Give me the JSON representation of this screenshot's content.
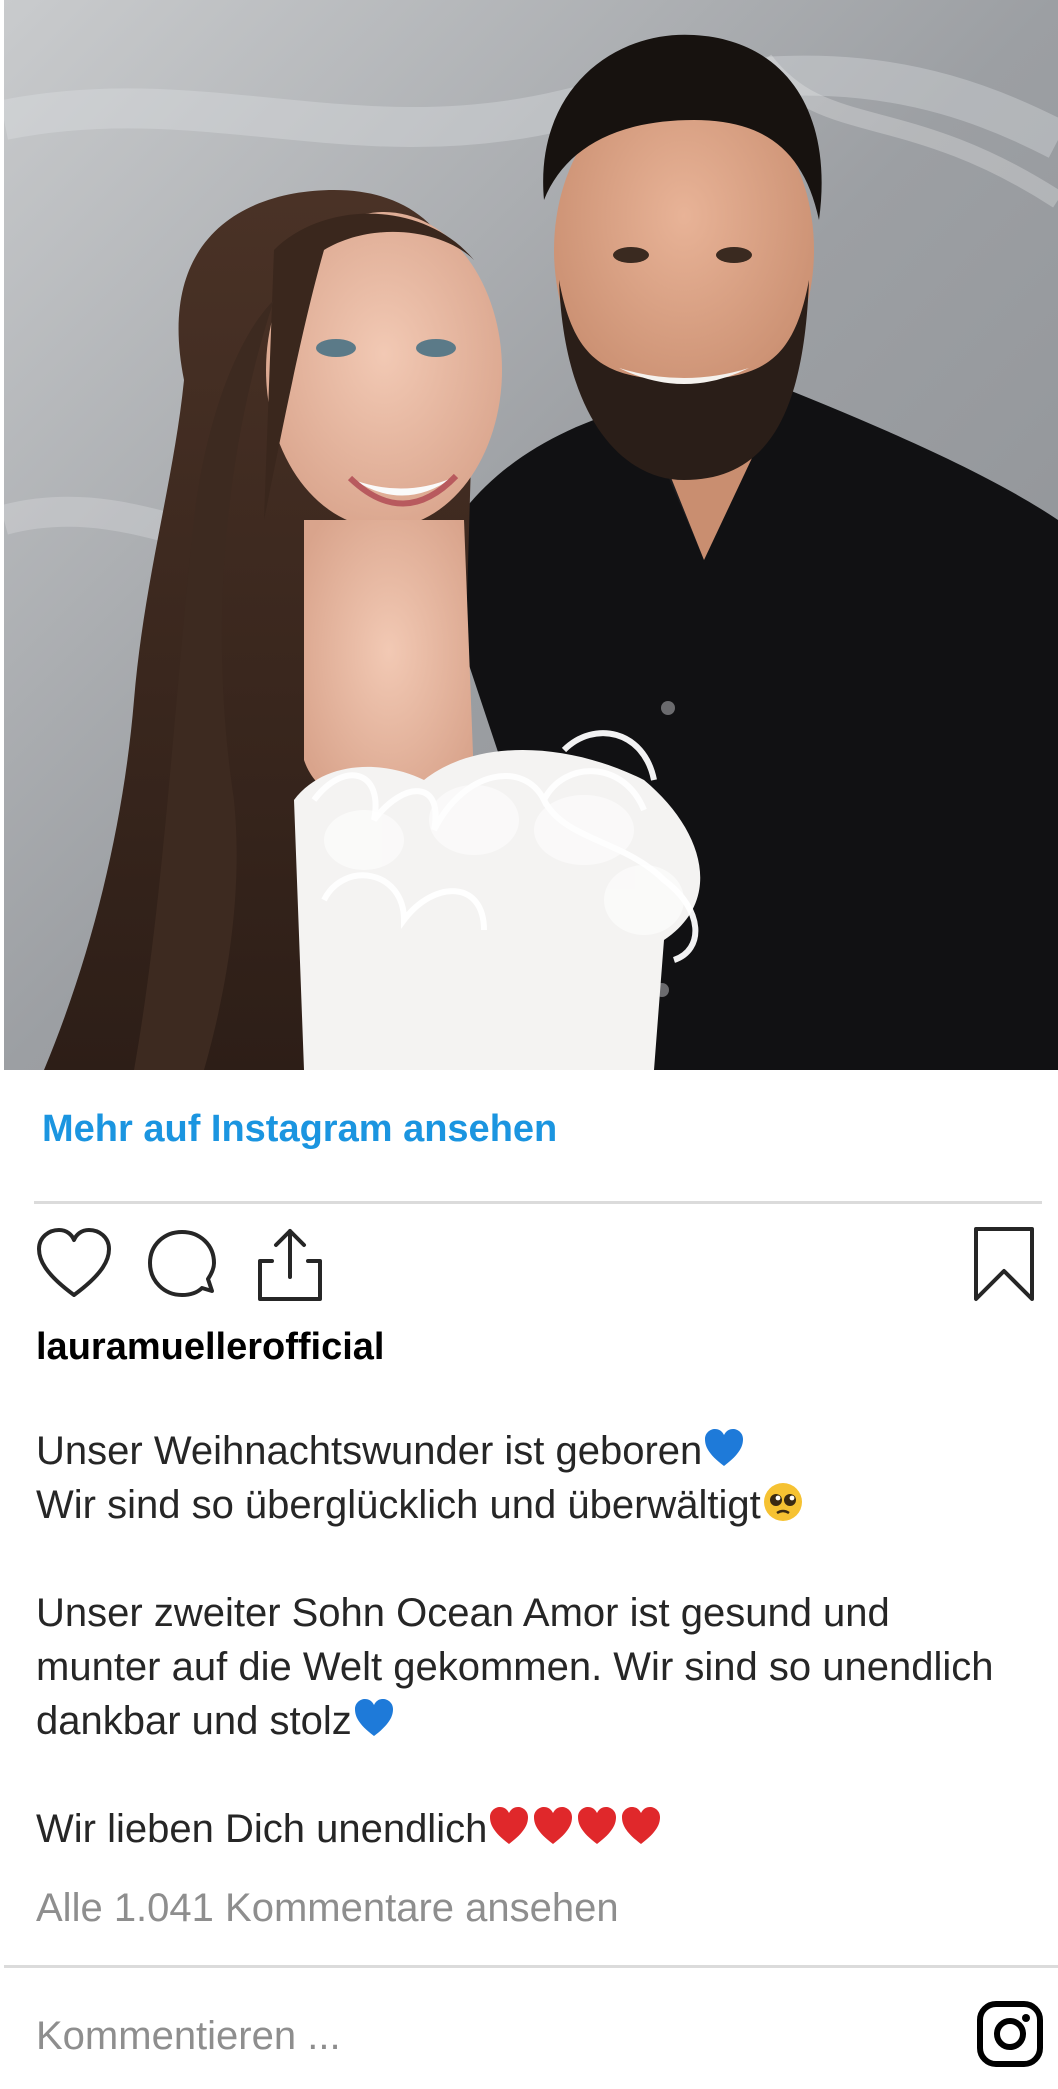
{
  "post": {
    "more_link": "Mehr auf Instagram ansehen",
    "username": "lauramuellerofficial",
    "caption_lines": [
      {
        "text": "Unser Weihnachtswunder ist geboren",
        "emojis": [
          "blue-heart"
        ]
      },
      {
        "text": "Wir sind so überglücklich und überwältigt",
        "emojis": [
          "pleading-face"
        ]
      },
      {
        "text": "",
        "emojis": []
      },
      {
        "text": "Unser zweiter Sohn Ocean Amor ist gesund und",
        "emojis": []
      },
      {
        "text": "munter auf die Welt gekommen. Wir sind so unendlich",
        "emojis": []
      },
      {
        "text": "dankbar und stolz",
        "emojis": [
          "blue-heart"
        ]
      },
      {
        "text": "",
        "emojis": []
      },
      {
        "text": "Wir lieben Dich unendlich",
        "emojis": [
          "red-heart",
          "red-heart",
          "red-heart",
          "red-heart"
        ]
      }
    ],
    "view_comments": "Alle 1.041 Kommentare ansehen",
    "comment_placeholder": "Kommentieren ...",
    "icons": [
      "heart-icon",
      "comment-icon",
      "share-icon",
      "bookmark-icon",
      "instagram-logo-icon"
    ]
  },
  "colors": {
    "link": "#1b95e0",
    "text": "#262626",
    "muted": "#8e8e8e",
    "divider": "#dbdbdb",
    "blue_heart": "#1e7ad9",
    "red_heart": "#e0282b"
  }
}
